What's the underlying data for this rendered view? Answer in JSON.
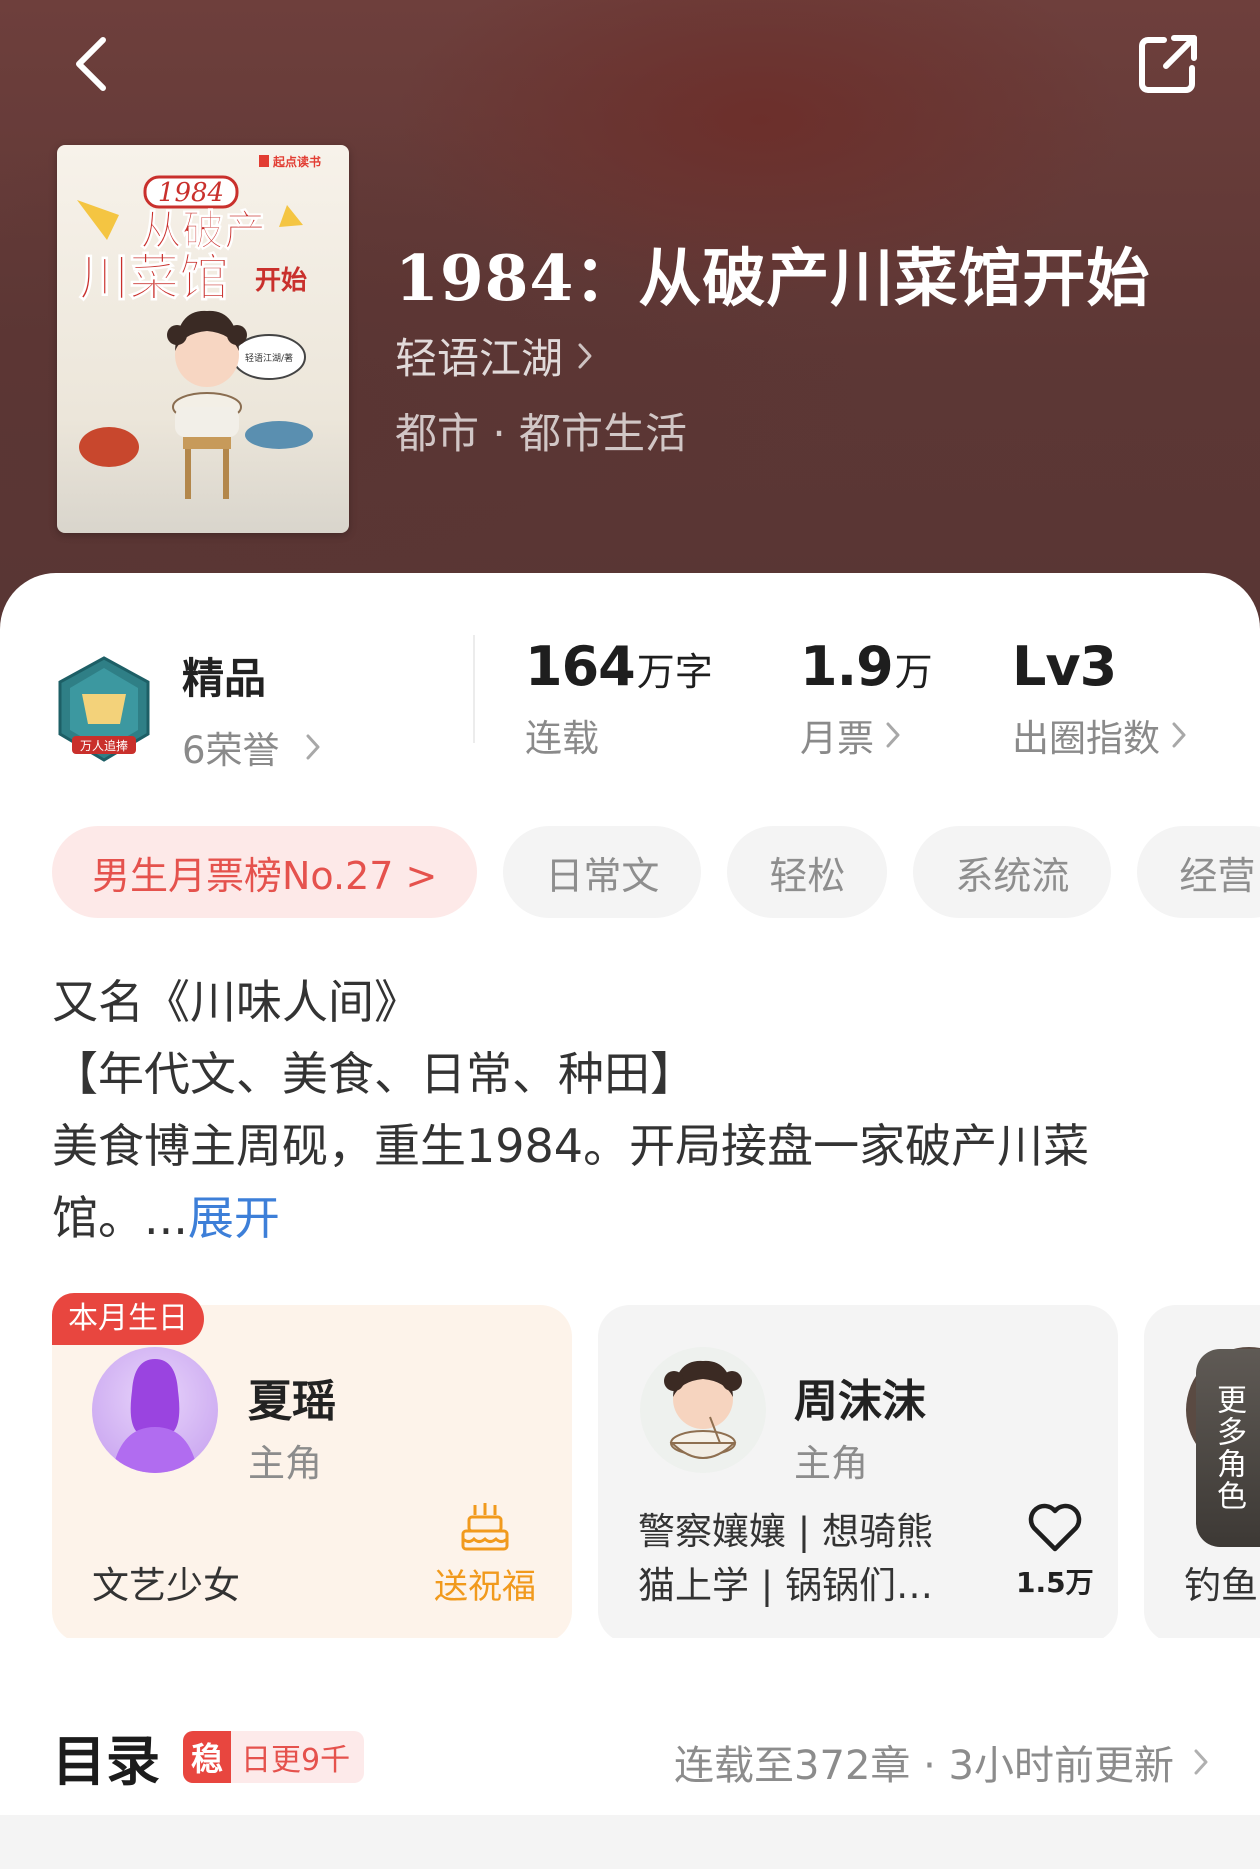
{
  "book": {
    "title": "1984：从破产川菜馆开始",
    "author": "轻语江湖",
    "genre": "都市 · 都市生活"
  },
  "cover": {
    "publisher": "起点读书",
    "line1": "1984",
    "line2": "从破产",
    "line3": "川菜馆",
    "line4": "开始",
    "author_stamp": "轻语江湖/著"
  },
  "honor": {
    "badge_text": "万人追捧",
    "title": "精品",
    "subtitle": "6荣誉"
  },
  "stats": [
    {
      "num": "164",
      "unit": "万字",
      "label": "连载"
    },
    {
      "num": "1.9",
      "unit": "万",
      "label": "月票"
    },
    {
      "num": "Lv3",
      "unit": "",
      "label": "出圈指数"
    }
  ],
  "tags": [
    "男生月票榜No.27 >",
    "日常文",
    "轻松",
    "系统流",
    "经营"
  ],
  "intro": {
    "line1": "又名《川味人间》",
    "line2": "【年代文、美食、日常、种田】",
    "line3": "美食博主周砚，重生1984。开局接盘一家破产川菜",
    "line4": "馆。...",
    "expand": "展开"
  },
  "characters": [
    {
      "name": "夏瑶",
      "role": "主角",
      "badge": "本月生日",
      "tag": "文艺少女",
      "action": "送祝福"
    },
    {
      "name": "周沫沫",
      "role": "主角",
      "tags_line1": "警察孃孃 | 想骑熊",
      "tags_line2": "猫上学 | 锅锅们…",
      "likes": "1.5万"
    },
    {
      "more_label": "更多角色",
      "partial_tag": "钓鱼"
    }
  ],
  "catalog": {
    "title": "目录",
    "badge_stamp": "稳",
    "badge_text": "日更9千",
    "status": "连载至372章 · 3小时前更新"
  },
  "colors": {
    "accent_red": "#e8463f",
    "blessing_orange": "#f19a1d",
    "link_blue": "#3d7fd8",
    "header_bg": "#5d3735"
  },
  "icons": [
    "back-arrow-icon",
    "share-icon",
    "chevron-right-icon",
    "honor-badge-icon",
    "cake-icon",
    "heart-icon"
  ]
}
